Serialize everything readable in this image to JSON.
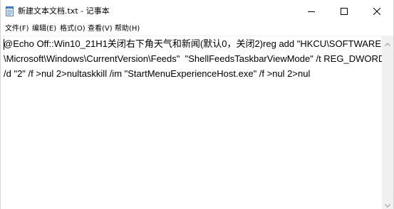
{
  "window": {
    "title": "新建文本文档.txt - 记事本"
  },
  "menu": {
    "items": [
      "文件(F)",
      "编辑(E)",
      "格式(O)",
      "查看(V)",
      "帮助(H)"
    ]
  },
  "editor": {
    "lines": [
      "@Echo Off::Win10_21H1关闭右下角天气和新闻(默认0，关闭2)reg add \"HKCU\\SOFTWARE",
      "\\Microsoft\\Windows\\CurrentVersion\\Feeds\"  \"ShellFeedsTaskbarViewMode\" /t REG_DWORD",
      "/d \"2\" /f >nul 2>nultaskkill /im \"StartMenuExperienceHost.exe\" /f >nul 2>nul"
    ]
  },
  "icons": {
    "app": "notepad-icon",
    "minimize": "minimize-icon",
    "maximize": "maximize-icon",
    "close": "close-icon",
    "scroll_up": "chevron-up-icon",
    "scroll_down": "chevron-down-icon"
  },
  "colors": {
    "background": "#ffffff",
    "text": "#000000",
    "scrollbar": "#f0f0f0"
  }
}
